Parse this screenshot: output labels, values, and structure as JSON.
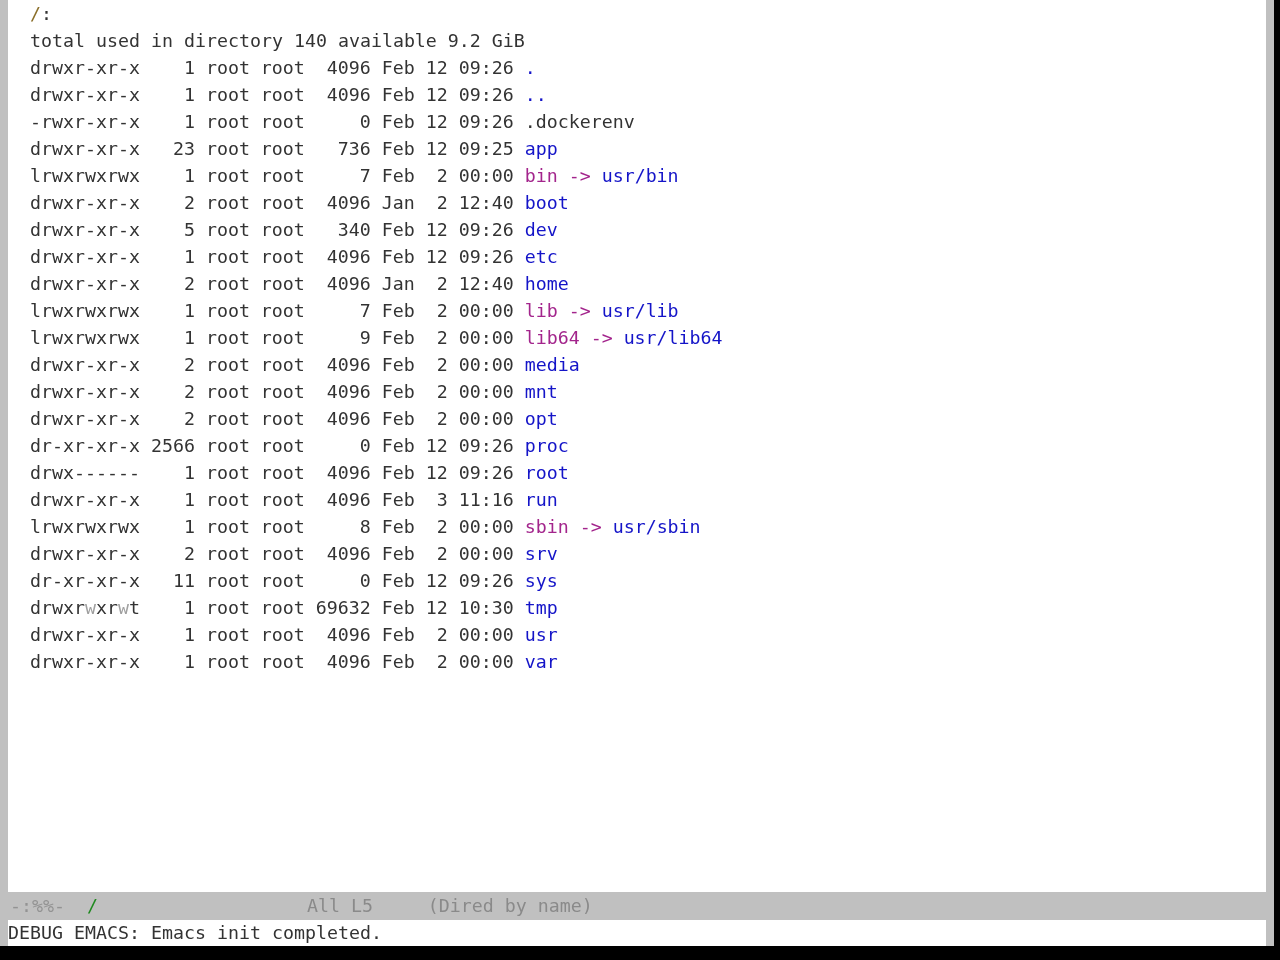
{
  "buffer": {
    "header": {
      "path": "/",
      "colon": ":"
    },
    "summary": "total used in directory 140 available 9.2 GiB",
    "entries": [
      {
        "kind": "dir",
        "permissions": "drwxr-xr-x",
        "links": "1",
        "owner": "root",
        "group": "root",
        "size": "4096",
        "month": "Feb",
        "day": "12",
        "time": "09:26",
        "name": "."
      },
      {
        "kind": "dir",
        "permissions": "drwxr-xr-x",
        "links": "1",
        "owner": "root",
        "group": "root",
        "size": "4096",
        "month": "Feb",
        "day": "12",
        "time": "09:26",
        "name": ".."
      },
      {
        "kind": "file",
        "permissions": "-rwxr-xr-x",
        "links": "1",
        "owner": "root",
        "group": "root",
        "size": "0",
        "month": "Feb",
        "day": "12",
        "time": "09:26",
        "name": ".dockerenv"
      },
      {
        "kind": "dir",
        "permissions": "drwxr-xr-x",
        "links": "23",
        "owner": "root",
        "group": "root",
        "size": "736",
        "month": "Feb",
        "day": "12",
        "time": "09:25",
        "name": "app"
      },
      {
        "kind": "symlink",
        "permissions": "lrwxrwxrwx",
        "links": "1",
        "owner": "root",
        "group": "root",
        "size": "7",
        "month": "Feb",
        "day": "2",
        "time": "00:00",
        "name": "bin",
        "arrow": "->",
        "target": "usr/bin"
      },
      {
        "kind": "dir",
        "permissions": "drwxr-xr-x",
        "links": "2",
        "owner": "root",
        "group": "root",
        "size": "4096",
        "month": "Jan",
        "day": "2",
        "time": "12:40",
        "name": "boot"
      },
      {
        "kind": "dir",
        "permissions": "drwxr-xr-x",
        "links": "5",
        "owner": "root",
        "group": "root",
        "size": "340",
        "month": "Feb",
        "day": "12",
        "time": "09:26",
        "name": "dev"
      },
      {
        "kind": "dir",
        "permissions": "drwxr-xr-x",
        "links": "1",
        "owner": "root",
        "group": "root",
        "size": "4096",
        "month": "Feb",
        "day": "12",
        "time": "09:26",
        "name": "etc"
      },
      {
        "kind": "dir",
        "permissions": "drwxr-xr-x",
        "links": "2",
        "owner": "root",
        "group": "root",
        "size": "4096",
        "month": "Jan",
        "day": "2",
        "time": "12:40",
        "name": "home"
      },
      {
        "kind": "symlink",
        "permissions": "lrwxrwxrwx",
        "links": "1",
        "owner": "root",
        "group": "root",
        "size": "7",
        "month": "Feb",
        "day": "2",
        "time": "00:00",
        "name": "lib",
        "arrow": "->",
        "target": "usr/lib"
      },
      {
        "kind": "symlink",
        "permissions": "lrwxrwxrwx",
        "links": "1",
        "owner": "root",
        "group": "root",
        "size": "9",
        "month": "Feb",
        "day": "2",
        "time": "00:00",
        "name": "lib64",
        "arrow": "->",
        "target": "usr/lib64"
      },
      {
        "kind": "dir",
        "permissions": "drwxr-xr-x",
        "links": "2",
        "owner": "root",
        "group": "root",
        "size": "4096",
        "month": "Feb",
        "day": "2",
        "time": "00:00",
        "name": "media"
      },
      {
        "kind": "dir",
        "permissions": "drwxr-xr-x",
        "links": "2",
        "owner": "root",
        "group": "root",
        "size": "4096",
        "month": "Feb",
        "day": "2",
        "time": "00:00",
        "name": "mnt"
      },
      {
        "kind": "dir",
        "permissions": "drwxr-xr-x",
        "links": "2",
        "owner": "root",
        "group": "root",
        "size": "4096",
        "month": "Feb",
        "day": "2",
        "time": "00:00",
        "name": "opt"
      },
      {
        "kind": "dir",
        "permissions": "dr-xr-xr-x",
        "links": "2566",
        "owner": "root",
        "group": "root",
        "size": "0",
        "month": "Feb",
        "day": "12",
        "time": "09:26",
        "name": "proc"
      },
      {
        "kind": "dir",
        "permissions": "drwx------",
        "links": "1",
        "owner": "root",
        "group": "root",
        "size": "4096",
        "month": "Feb",
        "day": "12",
        "time": "09:26",
        "name": "root"
      },
      {
        "kind": "dir",
        "permissions": "drwxr-xr-x",
        "links": "1",
        "owner": "root",
        "group": "root",
        "size": "4096",
        "month": "Feb",
        "day": "3",
        "time": "11:16",
        "name": "run"
      },
      {
        "kind": "symlink",
        "permissions": "lrwxrwxrwx",
        "links": "1",
        "owner": "root",
        "group": "root",
        "size": "8",
        "month": "Feb",
        "day": "2",
        "time": "00:00",
        "name": "sbin",
        "arrow": "->",
        "target": "usr/sbin"
      },
      {
        "kind": "dir",
        "permissions": "drwxr-xr-x",
        "links": "2",
        "owner": "root",
        "group": "root",
        "size": "4096",
        "month": "Feb",
        "day": "2",
        "time": "00:00",
        "name": "srv"
      },
      {
        "kind": "dir",
        "permissions": "dr-xr-xr-x",
        "links": "11",
        "owner": "root",
        "group": "root",
        "size": "0",
        "month": "Feb",
        "day": "12",
        "time": "09:26",
        "name": "sys"
      },
      {
        "kind": "dir",
        "permissions": [
          {
            "text": "drwxr",
            "highlighted": false
          },
          {
            "text": "w",
            "highlighted": true
          },
          {
            "text": "xr",
            "highlighted": false
          },
          {
            "text": "w",
            "highlighted": true
          },
          {
            "text": "t",
            "highlighted": false
          }
        ],
        "links": "1",
        "owner": "root",
        "group": "root",
        "size": "69632",
        "month": "Feb",
        "day": "12",
        "time": "10:30",
        "name": "tmp"
      },
      {
        "kind": "dir",
        "permissions": "drwxr-xr-x",
        "links": "1",
        "owner": "root",
        "group": "root",
        "size": "4096",
        "month": "Feb",
        "day": "2",
        "time": "00:00",
        "name": "usr"
      },
      {
        "kind": "dir",
        "permissions": "drwxr-xr-x",
        "links": "1",
        "owner": "root",
        "group": "root",
        "size": "4096",
        "month": "Feb",
        "day": "2",
        "time": "00:00",
        "name": "var"
      }
    ]
  },
  "mode_line": {
    "status": "-:%%-",
    "buffer_name": "/",
    "position": "All L5",
    "mode": "(Dired by name)"
  },
  "echo_area": {
    "message": "DEBUG EMACS: Emacs init completed."
  }
}
